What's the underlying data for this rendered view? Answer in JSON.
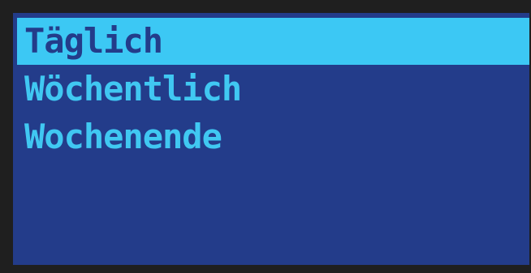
{
  "menu": {
    "items": [
      {
        "label": "Täglich",
        "selected": true
      },
      {
        "label": "Wöchentlich",
        "selected": false
      },
      {
        "label": "Wochenende",
        "selected": false
      }
    ]
  },
  "colors": {
    "bezel": "#1f1f1f",
    "screen_background": "#233c8a",
    "text": "#40c8f2",
    "highlight": "#3cc8f4"
  }
}
